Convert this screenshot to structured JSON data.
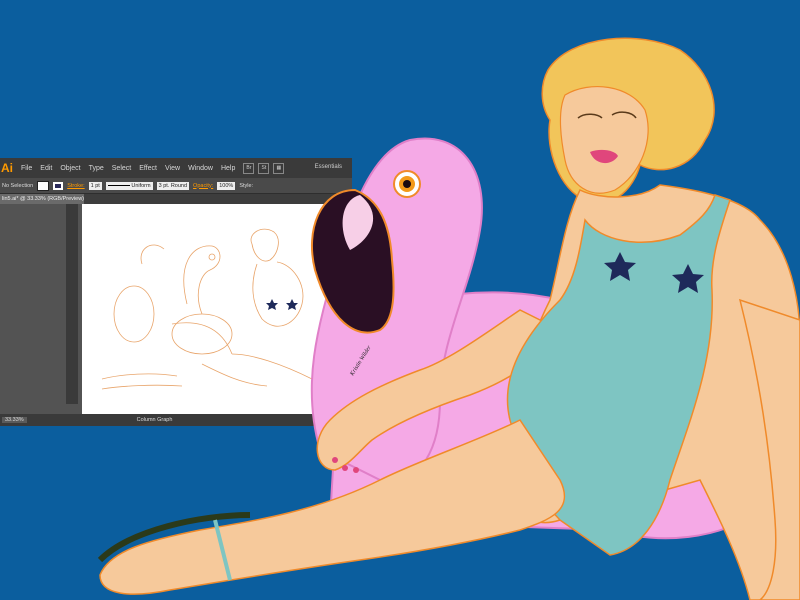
{
  "colors": {
    "background": "#0b5e9e",
    "skin": "#f6c99b",
    "hair": "#f2c55a",
    "swimsuit": "#7ec5c2",
    "flamingo": "#f5a9e6",
    "outline": "#f08a2a"
  },
  "window": {
    "app_logo": "Ai",
    "menus": [
      "File",
      "Edit",
      "Object",
      "Type",
      "Select",
      "Effect",
      "View",
      "Window",
      "Help"
    ],
    "workspace": "Essentials",
    "selection_label": "No Selection",
    "stroke_label": "Stroke:",
    "stroke_weight": "1 pt",
    "stroke_profile": "Uniform",
    "brush": "3 pt. Round",
    "opacity_label": "Opacity:",
    "opacity_value": "100%",
    "style_label": "Style:",
    "document_tab": "lin5.ai* @ 33.33% (RGB/Preview)",
    "zoom": "33.33%",
    "status": "Column Graph"
  },
  "signature": "Kristin Wilder"
}
